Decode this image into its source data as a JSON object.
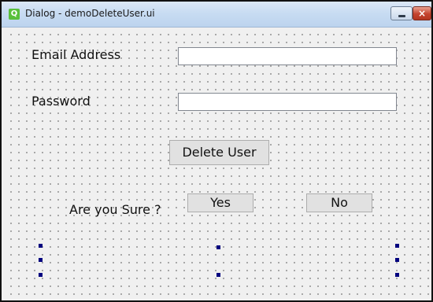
{
  "window": {
    "title": "Dialog - demoDeleteUser.ui",
    "app_icon_glyph": "Q",
    "minimize_glyph": "",
    "close_glyph": "×",
    "icon_names": [
      "qt-app-icon",
      "minimize-icon",
      "close-icon"
    ]
  },
  "form": {
    "email_label": "Email Address",
    "email_value": "",
    "password_label": "Password",
    "password_value": "",
    "delete_button": "Delete User",
    "confirm_label": "Are you Sure ?",
    "yes_button": "Yes",
    "no_button": "No"
  },
  "colors": {
    "titlebar": "#c8dcf2",
    "close_button": "#c4432e",
    "form_background": "#f0f0f0",
    "grid_dot": "#9a9a9a",
    "selection_handle": "#00007f"
  }
}
